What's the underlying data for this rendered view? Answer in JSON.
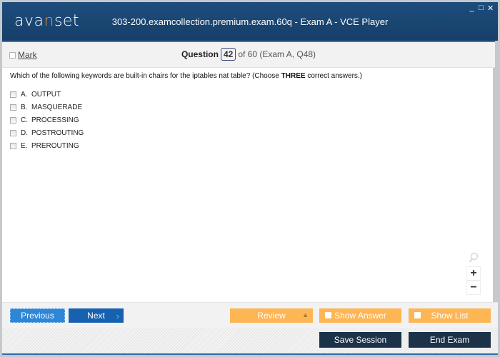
{
  "window": {
    "logo": {
      "pre": "ava",
      "accent": "n",
      "post": "set"
    },
    "title": "303-200.examcollection.premium.exam.60q - Exam A - VCE Player",
    "controls": {
      "minimize": "_",
      "maximize": "□",
      "close": "✕"
    }
  },
  "question_bar": {
    "mark_label": "Mark",
    "question_label": "Question",
    "current": "42",
    "rest": "of 60 (Exam A, Q48)"
  },
  "question": {
    "text_before": "Which of the following keywords are built-in chairs for the iptables nat table? (Choose ",
    "text_bold": "THREE",
    "text_after": " correct answers.)",
    "answers": [
      {
        "letter": "A.",
        "text": "OUTPUT",
        "checked": false
      },
      {
        "letter": "B.",
        "text": "MASQUERADE",
        "checked": false
      },
      {
        "letter": "C.",
        "text": "PROCESSING",
        "checked": false
      },
      {
        "letter": "D.",
        "text": "POSTROUTING",
        "checked": false
      },
      {
        "letter": "E.",
        "text": "PREROUTING",
        "checked": false
      }
    ]
  },
  "zoom": {
    "icon": "search-icon",
    "plus": "+",
    "minus": "−"
  },
  "nav": {
    "previous": "Previous",
    "next": "Next",
    "next_chevron": "›",
    "review": "Review",
    "review_arrow": "▲",
    "show_answer": "Show Answer",
    "show_list": "Show List"
  },
  "footer": {
    "save_session": "Save Session",
    "end_exam": "End Exam"
  },
  "colors": {
    "titlebar": "#1d4d7c",
    "accent_orange": "#feb554",
    "previous_blue": "#2e86d6",
    "next_blue": "#1662b0",
    "dark_button": "#1b3249"
  }
}
